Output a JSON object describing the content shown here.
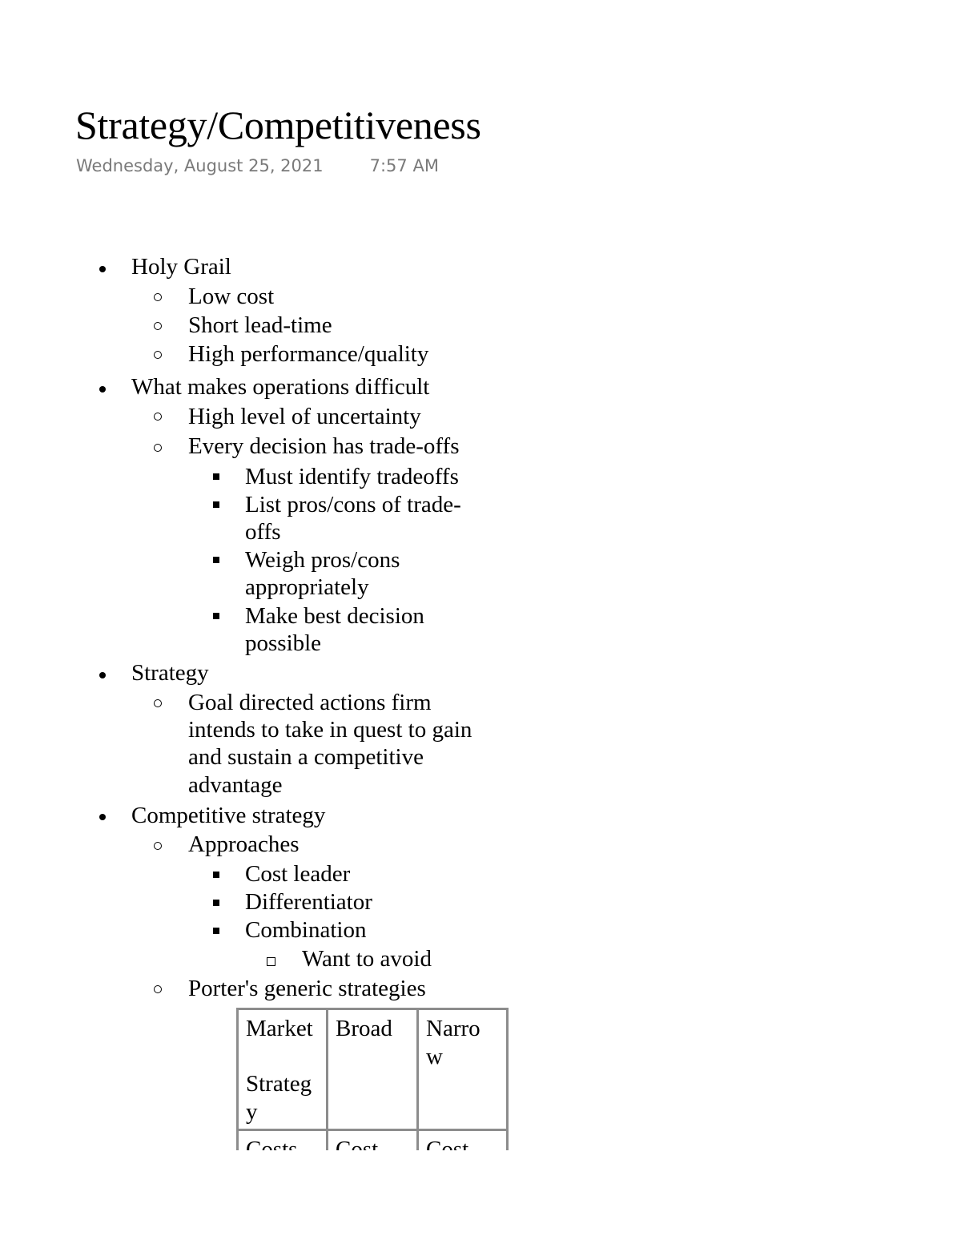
{
  "page": {
    "title": "Strategy/Competitiveness",
    "date": "Wednesday, August 25, 2021",
    "time": "7:57 AM"
  },
  "outline": [
    {
      "text": "Holy Grail",
      "children": [
        {
          "text": "Low cost"
        },
        {
          "text": "Short lead-time"
        },
        {
          "text": "High performance/quality"
        }
      ]
    },
    {
      "text": "What makes operations difficult",
      "children": [
        {
          "text": "High level of uncertainty"
        },
        {
          "text": "Every decision has trade-offs",
          "children": [
            {
              "text": "Must identify tradeoffs"
            },
            {
              "text": "List pros/cons of trade-offs",
              "lines": [
                "List pros/cons of trade-",
                "offs"
              ]
            },
            {
              "text": "Weigh pros/cons appropriately",
              "lines": [
                "Weigh pros/cons",
                "appropriately"
              ]
            },
            {
              "text": "Make best decision possible",
              "lines": [
                "Make best decision",
                "possible"
              ]
            }
          ]
        }
      ]
    },
    {
      "text": "Strategy",
      "children": [
        {
          "text": "Goal directed actions firm intends to take in quest to gain and sustain a competitive advantage",
          "lines": [
            "Goal directed actions firm",
            "intends to take in quest to gain",
            "and sustain a competitive",
            "advantage"
          ]
        }
      ]
    },
    {
      "text": "Competitive strategy",
      "children": [
        {
          "text": "Approaches",
          "children": [
            {
              "text": "Cost leader"
            },
            {
              "text": "Differentiator"
            },
            {
              "text": "Combination",
              "children": [
                {
                  "text": "Want to avoid"
                }
              ]
            }
          ]
        },
        {
          "text": "Porter's generic strategies"
        }
      ]
    }
  ],
  "porter_table": {
    "header": [
      {
        "lines": [
          "Market",
          "",
          "Strateg",
          "y"
        ]
      },
      {
        "lines": [
          "Broad"
        ]
      },
      {
        "lines": [
          "Narro",
          "w"
        ]
      }
    ],
    "row1": [
      {
        "text": "Costs"
      },
      {
        "text": "Cost"
      },
      {
        "text": "Cost"
      }
    ]
  }
}
